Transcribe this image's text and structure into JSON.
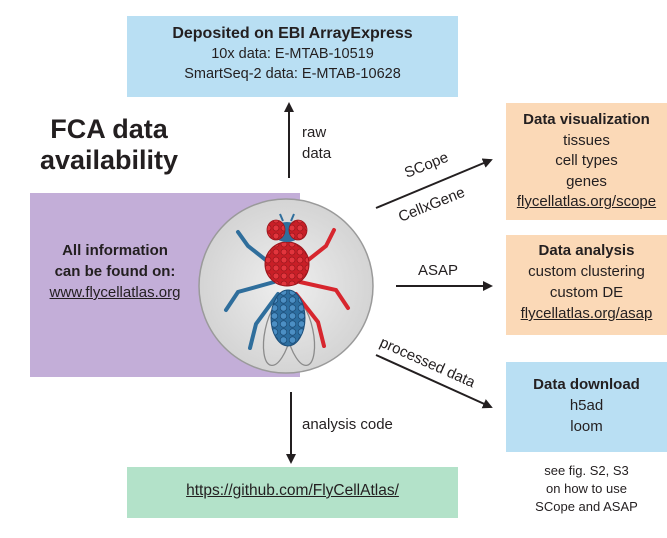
{
  "title": {
    "line1": "FCA data",
    "line2": "availability"
  },
  "deposit": {
    "heading": "Deposited on EBI ArrayExpress",
    "line1": "10x data: E-MTAB-10519",
    "line2": "SmartSeq-2 data: E-MTAB-10628"
  },
  "center": {
    "line1": "All information",
    "line2": "can be found on:",
    "url": "www.flycellatlas.org"
  },
  "visualization": {
    "heading": "Data visualization",
    "items": [
      "tissues",
      "cell types",
      "genes"
    ],
    "url": "flycellatlas.org/scope"
  },
  "analysis": {
    "heading": "Data analysis",
    "items": [
      "custom clustering",
      "custom DE"
    ],
    "url": "flycellatlas.org/asap"
  },
  "download": {
    "heading": "Data download",
    "items": [
      "h5ad",
      "loom"
    ]
  },
  "github": {
    "url": "https://github.com/FlyCellAtlas/"
  },
  "note": {
    "line1": "see fig. S2, S3",
    "line2": "on how to use",
    "line3": "SCope and ASAP"
  },
  "arrows": {
    "raw_line1": "raw",
    "raw_line2": "data",
    "scope": "SCope",
    "cellxgene": "CellxGene",
    "asap": "ASAP",
    "processed": "processed data",
    "code": "analysis code"
  },
  "colors": {
    "blue_box": "#b9dff3",
    "peach_box": "#fbd9b7",
    "green_box": "#b3e2c9",
    "lilac_panel": "#c3aed8",
    "fly_red": "#d7262e",
    "fly_blue": "#2f6e9c"
  }
}
